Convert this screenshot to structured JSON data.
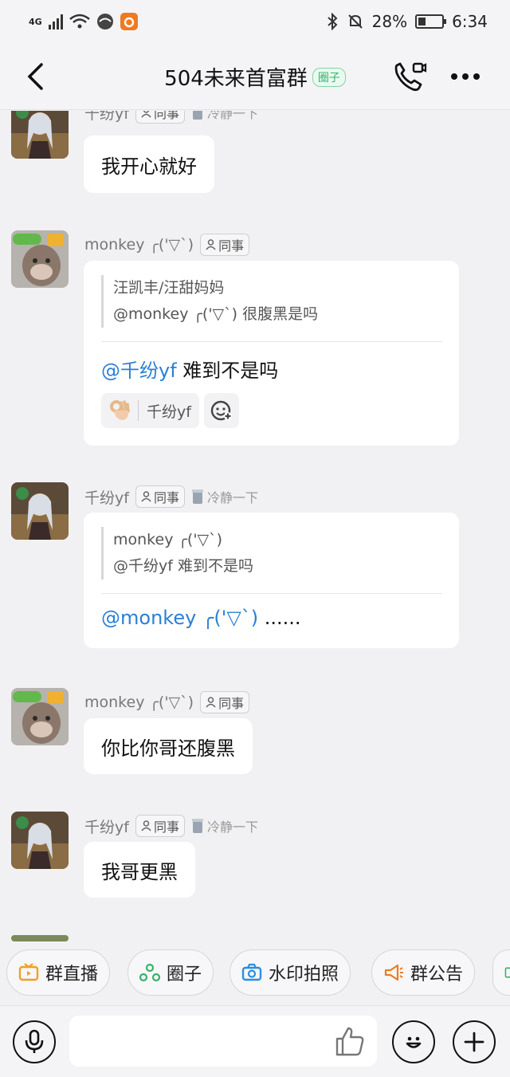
{
  "status_bar": {
    "network": "4G",
    "battery": "28%",
    "time": "6:34"
  },
  "header": {
    "title": "504未来首富群",
    "tag": "圈子"
  },
  "messages": [
    {
      "sender": "千纷yf",
      "role": "同事",
      "badge": "冷静一下",
      "text": "我开心就好"
    },
    {
      "sender": "monkey ╭('▽`)",
      "role": "同事",
      "quote_author": "汪凯丰/汪甜妈妈",
      "quote_text": "@monkey ╭('▽`) 很腹黑是吗",
      "reply_mention": "@千纷yf",
      "reply_text": " 难到不是吗",
      "reaction_user": "千纷yf"
    },
    {
      "sender": "千纷yf",
      "role": "同事",
      "badge": "冷静一下",
      "quote_author": "monkey ╭('▽`)",
      "quote_text": "@千纷yf 难到不是吗",
      "reply_mention": "@monkey ╭('▽`)",
      "reply_text": " ......"
    },
    {
      "sender": "monkey ╭('▽`)",
      "role": "同事",
      "text": "你比你哥还腹黑"
    },
    {
      "sender": "千纷yf",
      "role": "同事",
      "badge": "冷静一下",
      "text": "我哥更黑"
    }
  ],
  "quick_actions": [
    {
      "label": "群直播",
      "icon": "tv-icon",
      "color": "#f0a020"
    },
    {
      "label": "圈子",
      "icon": "circle-group-icon",
      "color": "#36b36a"
    },
    {
      "label": "水印拍照",
      "icon": "camera-icon",
      "color": "#2b8fe0"
    },
    {
      "label": "群公告",
      "icon": "megaphone-icon",
      "color": "#f07a20"
    }
  ],
  "colors": {
    "mention": "#2b7fd6",
    "accent_green": "#36b36a"
  }
}
